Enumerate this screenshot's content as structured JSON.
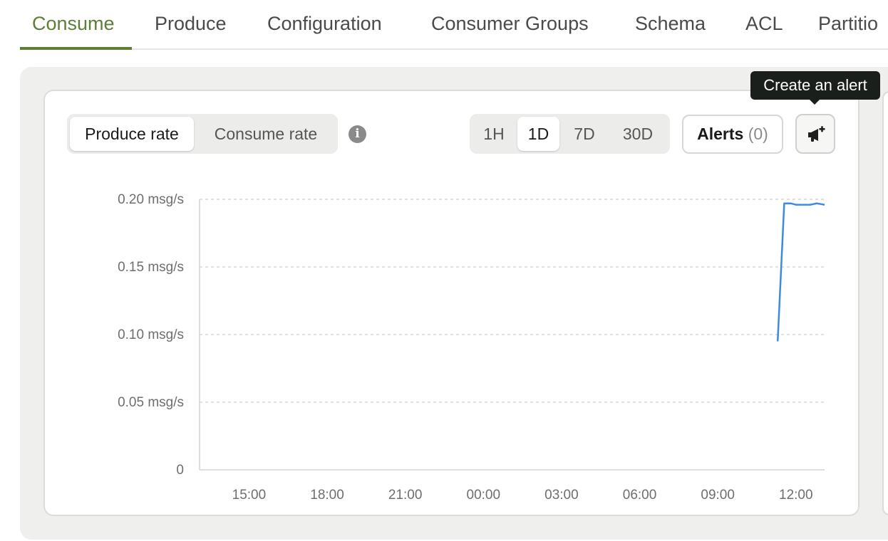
{
  "tabs": [
    {
      "label": "Consume",
      "active": true
    },
    {
      "label": "Produce",
      "active": false
    },
    {
      "label": "Configuration",
      "active": false
    },
    {
      "label": "Consumer Groups",
      "active": false
    },
    {
      "label": "Schema",
      "active": false
    },
    {
      "label": "ACL",
      "active": false
    },
    {
      "label": "Partitio",
      "active": false
    }
  ],
  "rate_toggle": {
    "produce": "Produce rate",
    "consume": "Consume rate",
    "selected": "Produce rate"
  },
  "info_icon": "info-icon",
  "ranges": {
    "options": [
      "1H",
      "1D",
      "7D",
      "30D"
    ],
    "selected": "1D"
  },
  "alerts": {
    "label": "Alerts",
    "count": "(0)"
  },
  "create_alert_icon": "megaphone-plus-icon",
  "tooltip": "Create an alert",
  "colors": {
    "accent": "#5b7f36",
    "series": "#3d8be0"
  },
  "chart_data": {
    "type": "line",
    "title": "",
    "xlabel": "",
    "ylabel": "",
    "ylim": [
      0,
      0.2
    ],
    "y_ticks": [
      0,
      0.05,
      0.1,
      0.15,
      0.2
    ],
    "y_tick_labels": [
      "0",
      "0.05 msg/s",
      "0.10 msg/s",
      "0.15 msg/s",
      "0.20 msg/s"
    ],
    "xlim": [
      13.1,
      37.1
    ],
    "x_ticks": [
      15,
      18,
      21,
      24,
      27,
      30,
      33,
      36
    ],
    "x_tick_labels": [
      "15:00",
      "18:00",
      "21:00",
      "00:00",
      "03:00",
      "06:00",
      "09:00",
      "12:00"
    ],
    "grid": "horizontal-dashed",
    "legend": "none",
    "series": [
      {
        "x": [
          35.3,
          35.55,
          35.8,
          36.0,
          36.3,
          36.55,
          36.8,
          37.1
        ],
        "y": [
          0.095,
          0.197,
          0.197,
          0.196,
          0.196,
          0.196,
          0.197,
          0.196
        ]
      }
    ]
  }
}
